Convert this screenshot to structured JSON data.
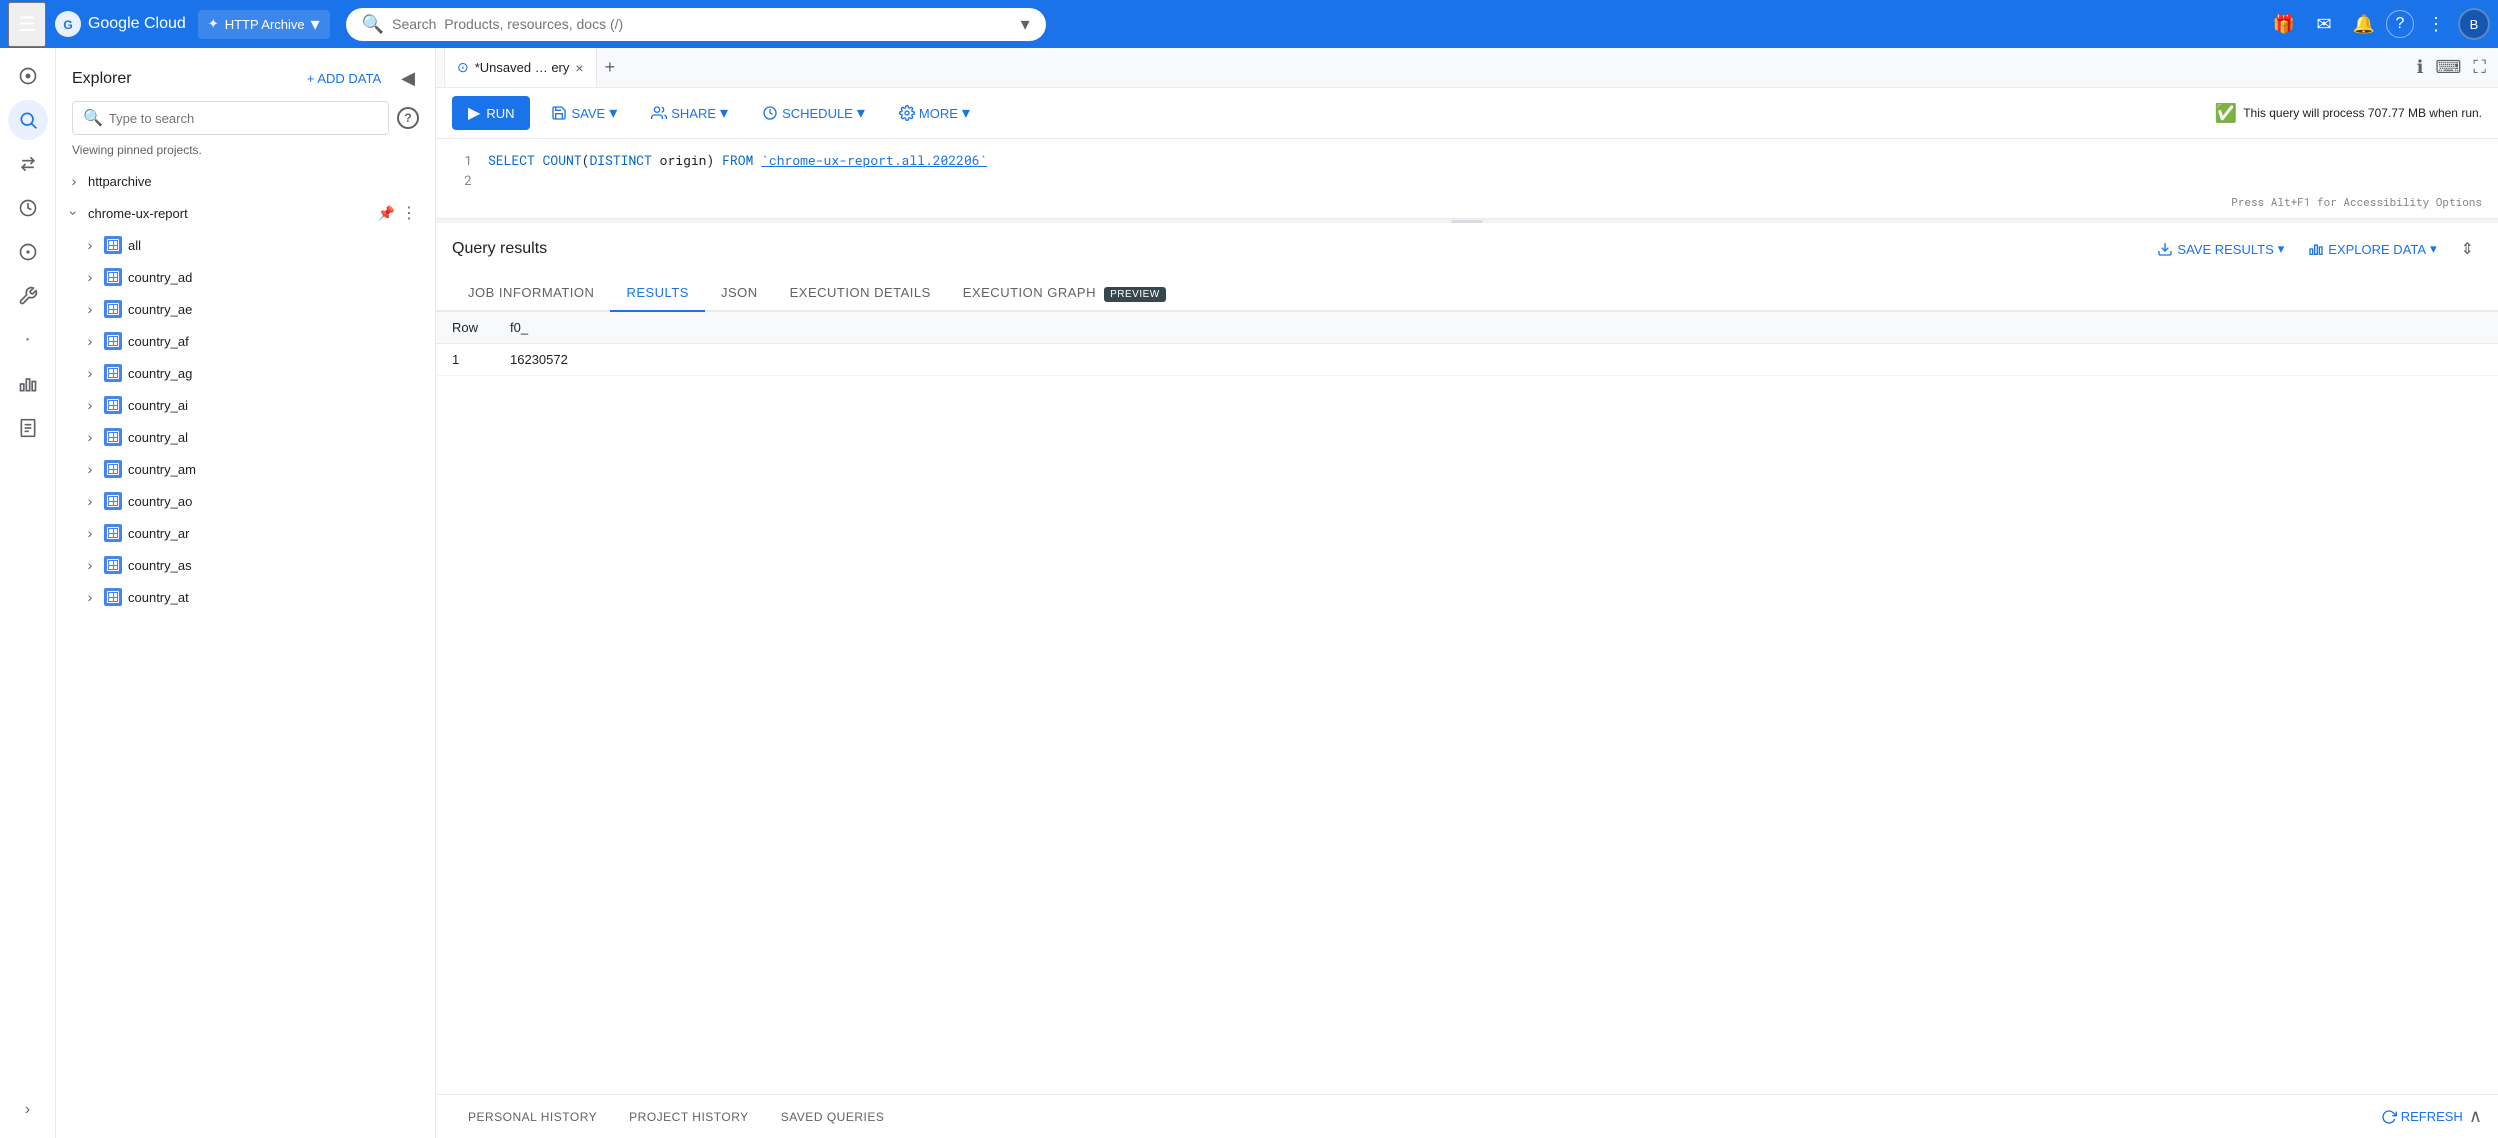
{
  "topbar": {
    "menu_icon": "☰",
    "logo_text": "Google Cloud",
    "project_name": "HTTP Archive",
    "search_placeholder": "Search  Products, resources, docs (/)",
    "gift_icon": "🎁",
    "email_icon": "✉",
    "bell_icon": "🔔",
    "help_icon": "?",
    "more_icon": "⋮",
    "avatar": "B"
  },
  "nav": {
    "icons": [
      "⊙",
      "🔍",
      "⇄",
      "🕐",
      "⚙",
      "🔧",
      "•",
      "📊",
      "📋"
    ],
    "expand_icon": "›"
  },
  "explorer": {
    "title": "Explorer",
    "add_data_label": "+ ADD DATA",
    "collapse_icon": "◀",
    "search_placeholder": "Type to search",
    "help_char": "?",
    "viewing_text": "Viewing pinned projects.",
    "tree": [
      {
        "id": "httparchive",
        "label": "httparchive",
        "expanded": false,
        "hasIcon": false
      },
      {
        "id": "chrome-ux-report",
        "label": "chrome-ux-report",
        "expanded": true,
        "hasPin": true,
        "children": [
          {
            "id": "all",
            "label": "all",
            "hasIcon": true
          },
          {
            "id": "country_ad",
            "label": "country_ad",
            "hasIcon": true
          },
          {
            "id": "country_ae",
            "label": "country_ae",
            "hasIcon": true
          },
          {
            "id": "country_af",
            "label": "country_af",
            "hasIcon": true
          },
          {
            "id": "country_ag",
            "label": "country_ag",
            "hasIcon": true
          },
          {
            "id": "country_ai",
            "label": "country_ai",
            "hasIcon": true
          },
          {
            "id": "country_al",
            "label": "country_al",
            "hasIcon": true
          },
          {
            "id": "country_am",
            "label": "country_am",
            "hasIcon": true
          },
          {
            "id": "country_ao",
            "label": "country_ao",
            "hasIcon": true
          },
          {
            "id": "country_ar",
            "label": "country_ar",
            "hasIcon": true
          },
          {
            "id": "country_as",
            "label": "country_as",
            "hasIcon": true
          },
          {
            "id": "country_at",
            "label": "country_at",
            "hasIcon": true
          }
        ]
      }
    ]
  },
  "query_editor": {
    "tab_label": "*Unsaved … ery",
    "tab_close": "×",
    "new_tab_icon": "+",
    "info_icon": "ℹ",
    "keyboard_icon": "⌨",
    "fullscreen_icon": "⛶",
    "run_label": "RUN",
    "save_label": "SAVE",
    "share_label": "SHARE",
    "schedule_label": "SCHEDULE",
    "more_label": "MORE",
    "process_info": "This query will process 707.77 MB when run.",
    "code_lines": [
      "SELECT COUNT(DISTINCT origin) FROM `chrome-ux-report.all.202206`",
      ""
    ]
  },
  "results": {
    "title": "Query results",
    "save_results_label": "SAVE RESULTS",
    "explore_data_label": "EXPLORE DATA",
    "tabs": [
      {
        "id": "job_info",
        "label": "JOB INFORMATION",
        "active": false
      },
      {
        "id": "results",
        "label": "RESULTS",
        "active": true
      },
      {
        "id": "json",
        "label": "JSON",
        "active": false
      },
      {
        "id": "execution_details",
        "label": "EXECUTION DETAILS",
        "active": false
      },
      {
        "id": "execution_graph",
        "label": "EXECUTION GRAPH",
        "active": false,
        "badge": "PREVIEW"
      }
    ],
    "table": {
      "columns": [
        "Row",
        "f0_"
      ],
      "rows": [
        {
          "row": "1",
          "value": "16230572"
        }
      ]
    }
  },
  "bottom_bar": {
    "tabs": [
      {
        "id": "personal_history",
        "label": "PERSONAL HISTORY"
      },
      {
        "id": "project_history",
        "label": "PROJECT HISTORY"
      },
      {
        "id": "saved_queries",
        "label": "SAVED QUERIES"
      }
    ],
    "refresh_label": "REFRESH",
    "collapse_icon": "∧"
  },
  "accessibility_hint": "Press Alt+F1 for Accessibility Options"
}
